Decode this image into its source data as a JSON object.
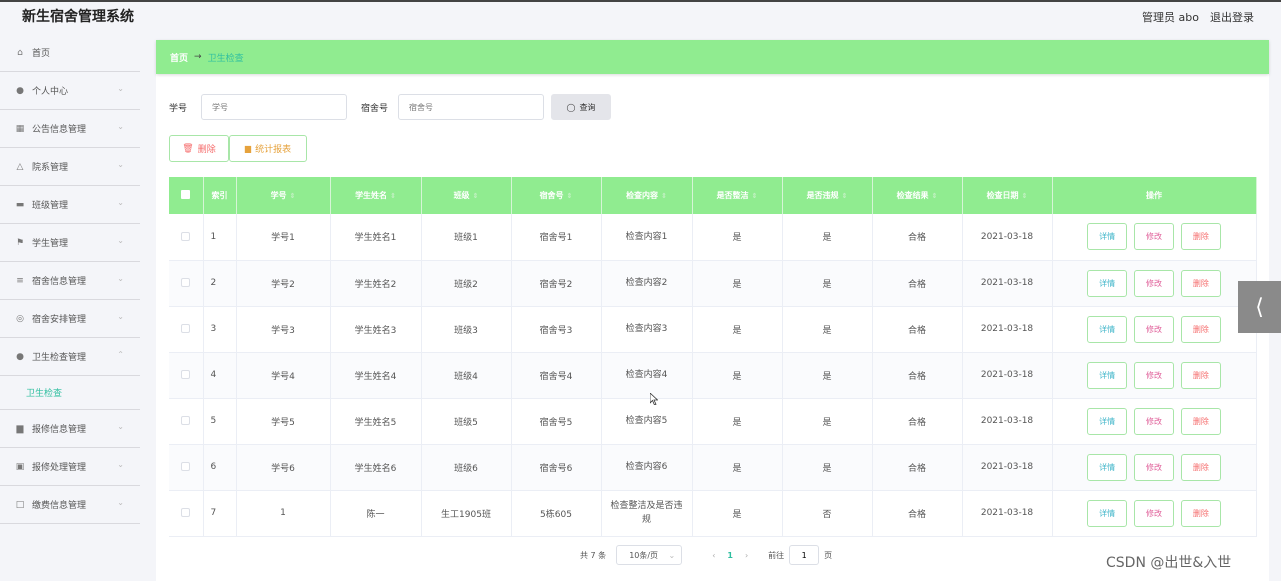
{
  "header": {
    "title": "新生宿舍管理系统",
    "user": "管理员 abo",
    "logout": "退出登录"
  },
  "sidebar": {
    "items": [
      {
        "label": "首页",
        "icon": "home-icon"
      },
      {
        "label": "个人中心",
        "icon": "user-icon"
      },
      {
        "label": "公告信息管理",
        "icon": "grid-icon"
      },
      {
        "label": "院系管理",
        "icon": "bell-icon"
      },
      {
        "label": "班级管理",
        "icon": "message-icon"
      },
      {
        "label": "学生管理",
        "icon": "flag-icon"
      },
      {
        "label": "宿舍信息管理",
        "icon": "list-icon"
      },
      {
        "label": "宿舍安排管理",
        "icon": "compass-icon"
      },
      {
        "label": "卫生检查管理",
        "icon": "user-icon"
      },
      {
        "label": "报修信息管理",
        "icon": "bar-chart-icon"
      },
      {
        "label": "报修处理管理",
        "icon": "clipboard-icon"
      },
      {
        "label": "缴费信息管理",
        "icon": "chat-icon"
      }
    ],
    "submenu": "卫生检查"
  },
  "breadcrumb": {
    "home": "首页",
    "arrow": "→",
    "current": "卫生检查"
  },
  "search": {
    "student_id_label": "学号",
    "student_id_placeholder": "学号",
    "dorm_label": "宿舍号",
    "dorm_placeholder": "宿舍号",
    "query_button": "查询"
  },
  "actions": {
    "delete": "删除",
    "report": "统计报表"
  },
  "table": {
    "headers": [
      "索引",
      "学号",
      "学生姓名",
      "班级",
      "宿舍号",
      "检查内容",
      "是否整洁",
      "是否违规",
      "检查结果",
      "检查日期",
      "操作"
    ],
    "rows": [
      [
        "1",
        "学号1",
        "学生姓名1",
        "班级1",
        "宿舍号1",
        "检查内容1",
        "是",
        "是",
        "合格",
        "2021-03-18"
      ],
      [
        "2",
        "学号2",
        "学生姓名2",
        "班级2",
        "宿舍号2",
        "检查内容2",
        "是",
        "是",
        "合格",
        "2021-03-18"
      ],
      [
        "3",
        "学号3",
        "学生姓名3",
        "班级3",
        "宿舍号3",
        "检查内容3",
        "是",
        "是",
        "合格",
        "2021-03-18"
      ],
      [
        "4",
        "学号4",
        "学生姓名4",
        "班级4",
        "宿舍号4",
        "检查内容4",
        "是",
        "是",
        "合格",
        "2021-03-18"
      ],
      [
        "5",
        "学号5",
        "学生姓名5",
        "班级5",
        "宿舍号5",
        "检查内容5",
        "是",
        "是",
        "合格",
        "2021-03-18"
      ],
      [
        "6",
        "学号6",
        "学生姓名6",
        "班级6",
        "宿舍号6",
        "检查内容6",
        "是",
        "是",
        "合格",
        "2021-03-18"
      ],
      [
        "7",
        "1",
        "陈一",
        "生工1905班",
        "5栋605",
        "检查整洁及是否违规",
        "是",
        "否",
        "合格",
        "2021-03-18"
      ]
    ],
    "row_buttons": {
      "detail": "详情",
      "edit": "修改",
      "delete": "删除"
    }
  },
  "pagination": {
    "total": "共 7 条",
    "page_size": "10条/页",
    "current": "1",
    "goto_label": "前往",
    "goto_value": "1",
    "page_suffix": "页"
  },
  "colors": {
    "accent": "#90ec90",
    "teal": "#2fbfa0",
    "delete": "#f56c6c",
    "edit": "#e0609a",
    "report": "#e6a23c"
  },
  "watermark": "CSDN @出世&入世"
}
